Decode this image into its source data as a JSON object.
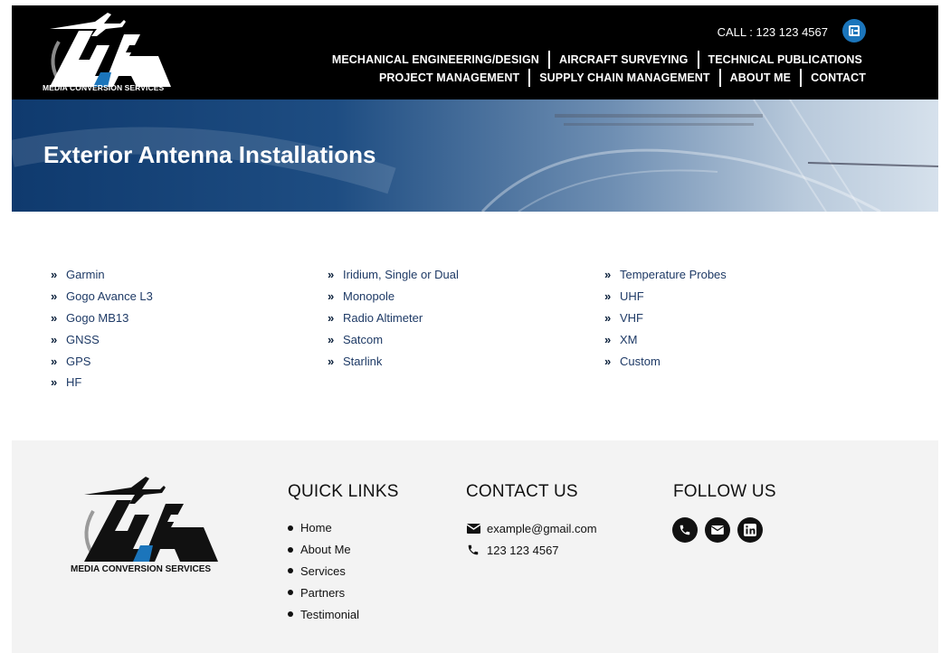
{
  "header": {
    "logo_caption": "MEDIA CONVERSION SERVICES",
    "call_text": "CALL : 123 123 4567",
    "linkedin_icon": "linkedin-icon",
    "nav_row1": [
      "MECHANICAL ENGINEERING/DESIGN",
      "AIRCRAFT SURVEYING",
      "TECHNICAL PUBLICATIONS"
    ],
    "nav_row2": [
      "PROJECT MANAGEMENT",
      "SUPPLY CHAIN MANAGEMENT",
      "ABOUT ME",
      "CONTACT"
    ]
  },
  "hero": {
    "title": "Exterior Antenna Installations"
  },
  "antenna_lists": {
    "col1": [
      "Garmin",
      "Gogo Avance L3",
      "Gogo MB13",
      "GNSS",
      "GPS",
      "HF"
    ],
    "col2": [
      "Iridium, Single or Dual",
      "Monopole",
      "Radio Altimeter",
      "Satcom",
      "Starlink"
    ],
    "col3": [
      "Temperature Probes",
      "UHF",
      "VHF",
      "XM",
      "Custom"
    ],
    "bullet_icon": "double-chevron-right-icon"
  },
  "footer": {
    "logo_caption": "MEDIA CONVERSION SERVICES",
    "quick_links_heading": "QUICK LINKS",
    "quick_links": [
      "Home",
      "About Me",
      "Services",
      "Partners",
      "Testimonial"
    ],
    "contact_heading": "CONTACT US",
    "contact_email": "example@gmail.com",
    "contact_phone": "123 123 4567",
    "follow_heading": "FOLLOW US",
    "social_icons": [
      "phone-icon",
      "email-icon",
      "linkedin-icon"
    ]
  },
  "colors": {
    "header_bg": "#000000",
    "accent_blue": "#1b75bb",
    "list_text": "#1e3a66",
    "footer_bg": "#f3f3f3"
  }
}
